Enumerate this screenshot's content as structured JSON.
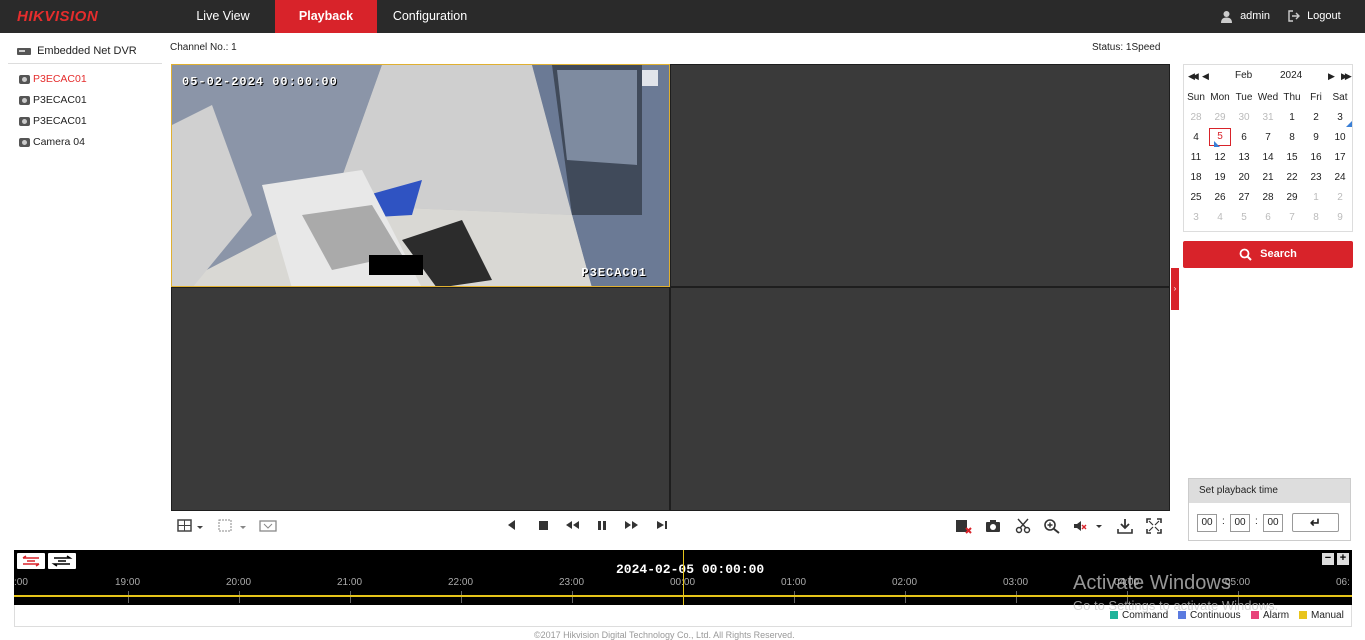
{
  "header": {
    "logo": "HIKVISION",
    "nav": [
      "Live View",
      "Playback",
      "Configuration"
    ],
    "user": "admin",
    "logout": "Logout"
  },
  "sidebar": {
    "device": "Embedded Net DVR",
    "cameras": [
      "P3ECAC01",
      "P3ECAC01",
      "P3ECAC01",
      "Camera 04"
    ]
  },
  "info": {
    "channel": "Channel No.: 1",
    "status": "Status: 1Speed"
  },
  "video": {
    "osd_time": "05-02-2024 00:00:00",
    "osd_name": "P3ECAC01"
  },
  "calendar": {
    "month": "Feb",
    "year": "2024",
    "weekdays": [
      "Sun",
      "Mon",
      "Tue",
      "Wed",
      "Thu",
      "Fri",
      "Sat"
    ],
    "weeks": [
      [
        "28",
        "29",
        "30",
        "31",
        "1",
        "2",
        "3"
      ],
      [
        "4",
        "5",
        "6",
        "7",
        "8",
        "9",
        "10"
      ],
      [
        "11",
        "12",
        "13",
        "14",
        "15",
        "16",
        "17"
      ],
      [
        "18",
        "19",
        "20",
        "21",
        "22",
        "23",
        "24"
      ],
      [
        "25",
        "26",
        "27",
        "28",
        "29",
        "1",
        "2"
      ],
      [
        "3",
        "4",
        "5",
        "6",
        "7",
        "8",
        "9"
      ]
    ],
    "selected": "5",
    "search_label": "Search"
  },
  "set_playback": {
    "title": "Set playback time",
    "hh": "00",
    "mm": "00",
    "ss": "00"
  },
  "timeline": {
    "date": "2024-02-05 00:00:00",
    "ticks": [
      ":00",
      "19:00",
      "20:00",
      "21:00",
      "22:00",
      "23:00",
      "00:00",
      "01:00",
      "02:00",
      "03:00",
      "04:00",
      "05:00",
      "06:"
    ]
  },
  "legend": {
    "items": [
      {
        "label": "Command",
        "color": "#1fb39a"
      },
      {
        "label": "Continuous",
        "color": "#5b7be0"
      },
      {
        "label": "Alarm",
        "color": "#e8437a"
      },
      {
        "label": "Manual",
        "color": "#e8c41c"
      }
    ]
  },
  "watermark": {
    "line1": "Activate Windows",
    "line2": "Go to Settings to activate Windows."
  },
  "footer": {
    "copyright": "©2017 Hikvision Digital Technology Co., Ltd. All Rights Reserved."
  }
}
